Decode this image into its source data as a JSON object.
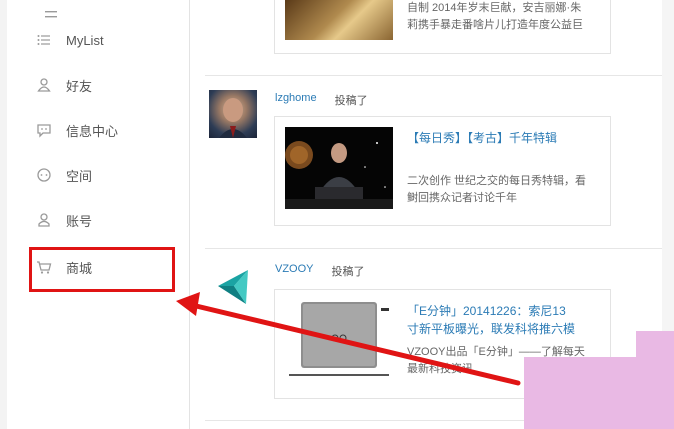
{
  "sidebar": {
    "items": [
      {
        "label": "MyList",
        "icon": "list-icon"
      },
      {
        "label": "好友",
        "icon": "friends-icon"
      },
      {
        "label": "信息中心",
        "icon": "message-icon"
      },
      {
        "label": "空间",
        "icon": "space-icon"
      },
      {
        "label": "账号",
        "icon": "account-icon"
      },
      {
        "label": "商城",
        "icon": "cart-icon"
      }
    ]
  },
  "feed": {
    "top_card": {
      "desc_line1": "自制 2014年岁末巨献，安吉丽娜·朱",
      "desc_line2": "莉携手暴走番啥片儿打造年度公益巨"
    },
    "posts": [
      {
        "user": "lzghome",
        "action": "投稿了",
        "title": "【每日秀】【考古】千年特辑",
        "desc_line1": "二次创作 世纪之交的每日秀特辑，看",
        "desc_line2": "鲥回携众记者讨论千年"
      },
      {
        "user": "VZOOY",
        "action": "投稿了",
        "title_line1": "「E分钟」20141226：索尼13",
        "title_line2": "寸新平板曝光，联发科将推六模",
        "desc_line1": "VZOOY出品「E分钟」——了解每天",
        "desc_line2": "最新科技资讯"
      }
    ]
  },
  "colors": {
    "highlight": "#e01414",
    "link": "#2b7bb5",
    "arrow": "#e01414"
  }
}
